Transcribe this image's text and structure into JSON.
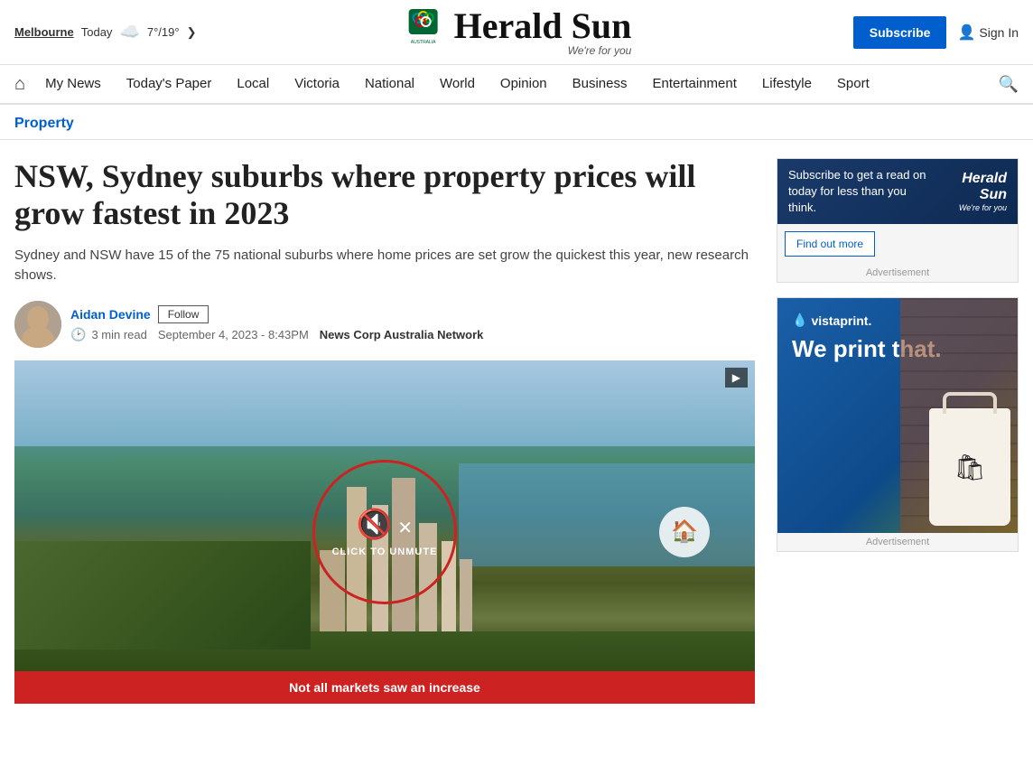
{
  "site": {
    "name": "Herald Sun",
    "tagline": "We're for you"
  },
  "location": {
    "city": "Melbourne",
    "today": "Today",
    "weather": "☁️",
    "temp": "7°/19°"
  },
  "topbar": {
    "subscribe_label": "Subscribe",
    "signin_label": "Sign In"
  },
  "nav": {
    "home_label": "🏠",
    "items": [
      {
        "label": "My News",
        "id": "my-news"
      },
      {
        "label": "Today's Paper",
        "id": "todays-paper"
      },
      {
        "label": "Local",
        "id": "local"
      },
      {
        "label": "Victoria",
        "id": "victoria"
      },
      {
        "label": "National",
        "id": "national"
      },
      {
        "label": "World",
        "id": "world"
      },
      {
        "label": "Opinion",
        "id": "opinion"
      },
      {
        "label": "Business",
        "id": "business"
      },
      {
        "label": "Entertainment",
        "id": "entertainment"
      },
      {
        "label": "Lifestyle",
        "id": "lifestyle"
      },
      {
        "label": "Sport",
        "id": "sport"
      }
    ]
  },
  "breadcrumb": {
    "label": "Property",
    "color": "#005fcc"
  },
  "article": {
    "title": "NSW, Sydney suburbs where property prices will grow fastest in 2023",
    "summary": "Sydney and NSW have 15 of the 75 national suburbs where home prices are set grow the quickest this year, new research shows.",
    "author": {
      "name": "Aidan Devine",
      "follow_label": "Follow"
    },
    "meta": {
      "read_time": "3 min read",
      "date": "September 4, 2023 - 8:43PM",
      "source": "News Corp Australia Network"
    },
    "video": {
      "unmute_label": "CLICK TO UNMUTE",
      "bottom_bar": "Not all markets saw an increase"
    }
  },
  "sidebar": {
    "ad_1": {
      "text": "Subscribe to get a read on today for less than you think.",
      "button": "Find out more",
      "brand": "Herald Sun",
      "label": "Advertisement"
    },
    "ad_2": {
      "brand": "vistaprint.",
      "tagline": "We print that.",
      "label": "Advertisement"
    }
  }
}
